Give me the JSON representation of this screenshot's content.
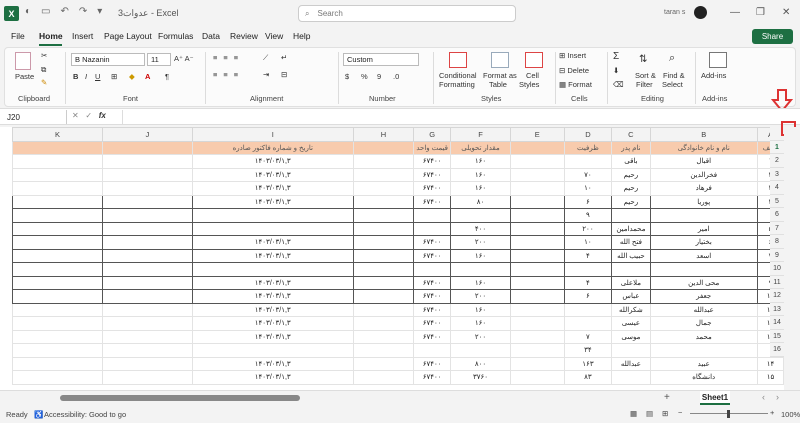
{
  "app": {
    "logo": "X",
    "title": "عدوات3 - Excel",
    "user": "taran s"
  },
  "search": {
    "placeholder": "Search"
  },
  "menu": [
    "File",
    "Home",
    "Insert",
    "Page Layout",
    "Formulas",
    "Data",
    "Review",
    "View",
    "Help"
  ],
  "share_label": "Share",
  "ribbon": {
    "clipboard": {
      "label": "Clipboard",
      "paste": "Paste"
    },
    "font": {
      "label": "Font",
      "name": "B Nazanin",
      "size": "11"
    },
    "alignment": {
      "label": "Alignment"
    },
    "number": {
      "label": "Number",
      "format": "Custom"
    },
    "styles": {
      "label": "Styles",
      "cond": "Conditional",
      "cond2": "Formatting",
      "fmt": "Format as",
      "fmt2": "Table",
      "cell": "Cell",
      "cell2": "Styles"
    },
    "cells": {
      "label": "Cells",
      "insert": "Insert",
      "delete": "Delete",
      "format": "Format"
    },
    "editing": {
      "label": "Editing",
      "sort": "Sort &",
      "sort2": "Filter",
      "find": "Find &",
      "find2": "Select"
    },
    "addins": {
      "label": "Add-ins",
      "btn": "Add-ins"
    }
  },
  "formula_bar": {
    "namebox": "J20",
    "fx": "fx"
  },
  "columns": [
    "K",
    "J",
    "I",
    "H",
    "G",
    "F",
    "E",
    "D",
    "C",
    "B",
    "A"
  ],
  "header_row": [
    "",
    "",
    "تاریخ و شماره فاکتور صادره",
    "",
    "قیمت واحد",
    "مقدار تحویلی",
    "",
    "ظرفیت",
    "نام پدر",
    "نام و نام خانوادگی",
    "ردیف"
  ],
  "rows": [
    [
      "",
      "",
      "۱۴۰۳/۰۳/۱,۳",
      "",
      "۶۷۴۰۰",
      "۱۶۰",
      "",
      "",
      "باقی",
      "اقبال",
      "۱"
    ],
    [
      "",
      "",
      "۱۴۰۳/۰۳/۱,۳",
      "",
      "۶۷۴۰۰",
      "۱۶۰",
      "",
      "۷۰",
      "رحیم",
      "فخرالدین",
      "۲"
    ],
    [
      "",
      "",
      "۱۴۰۳/۰۳/۱,۳",
      "",
      "۶۷۴۰۰",
      "۱۶۰",
      "",
      "۱۰",
      "رحیم",
      "فرهاد",
      "۳"
    ],
    [
      "",
      "",
      "۱۴۰۳/۰۳/۱,۳",
      "",
      "۶۷۴۰۰",
      "۸۰",
      "",
      "۶",
      "رحیم",
      "پوریا",
      "۴"
    ],
    [
      "",
      "",
      "",
      "",
      "",
      "",
      "",
      "۹",
      "",
      "",
      ""
    ],
    [
      "",
      "",
      "",
      "",
      "",
      "۴۰۰",
      "",
      "۲۰۰",
      "محمدامین",
      "امیر",
      "۵"
    ],
    [
      "",
      "",
      "۱۴۰۳/۰۳/۱,۳",
      "",
      "۶۷۴۰۰",
      "۲۰۰",
      "",
      "۱۰",
      "فتح الله",
      "بختیار",
      "۶"
    ],
    [
      "",
      "",
      "۱۴۰۳/۰۳/۱,۳",
      "",
      "۶۷۴۰۰",
      "۱۶۰",
      "",
      "۴",
      "حبیب الله",
      "اسعد",
      "۷"
    ],
    [
      "",
      "",
      "",
      "",
      "",
      "",
      "",
      "",
      "",
      "",
      ""
    ],
    [
      "",
      "",
      "۱۴۰۳/۰۳/۱,۳",
      "",
      "۶۷۴۰۰",
      "۱۶۰",
      "",
      "۴",
      "ملاعلی",
      "محی الدین",
      "۹"
    ],
    [
      "",
      "",
      "۱۴۰۳/۰۳/۱,۳",
      "",
      "۶۷۴۰۰",
      "۲۰۰",
      "",
      "۶",
      "عباس",
      "جعفر",
      "۱۰"
    ],
    [
      "",
      "",
      "۱۴۰۳/۰۳/۱,۳",
      "",
      "۶۷۴۰۰",
      "۱۶۰",
      "",
      "",
      "شکرالله",
      "عبدالله",
      "۱۱"
    ],
    [
      "",
      "",
      "۱۴۰۳/۰۳/۱,۳",
      "",
      "۶۷۴۰۰",
      "۱۶۰",
      "",
      "",
      "عیسی",
      "جمال",
      "۱۲"
    ],
    [
      "",
      "",
      "۱۴۰۳/۰۳/۱,۳",
      "",
      "۶۷۴۰۰",
      "۲۰۰",
      "",
      "۷",
      "موسی",
      "محمد",
      "۱۳"
    ],
    [
      "",
      "",
      "",
      "",
      "",
      "",
      "",
      "۳۴",
      "",
      "",
      ""
    ],
    [
      "",
      "",
      "۱۴۰۳/۰۳/۱,۳",
      "",
      "۶۷۴۰۰",
      "۸۰۰",
      "",
      "۱۶۳",
      "عبدالله",
      "عبید",
      "۱۴"
    ],
    [
      "",
      "",
      "۱۴۰۳/۰۳/۱,۳",
      "",
      "۶۷۴۰۰",
      "۳۷۶۰",
      "",
      "۸۳",
      "",
      "دانشگاه",
      "۱۵"
    ]
  ],
  "row_numbers": [
    "1",
    "2",
    "3",
    "4",
    "5",
    "6",
    "7",
    "8",
    "9",
    "10",
    "11",
    "12",
    "13",
    "14",
    "15",
    "16"
  ],
  "sheet_tab": "Sheet1",
  "status": {
    "ready": "Ready",
    "accessibility": "Accessibility: Good to go",
    "zoom": "100%"
  }
}
